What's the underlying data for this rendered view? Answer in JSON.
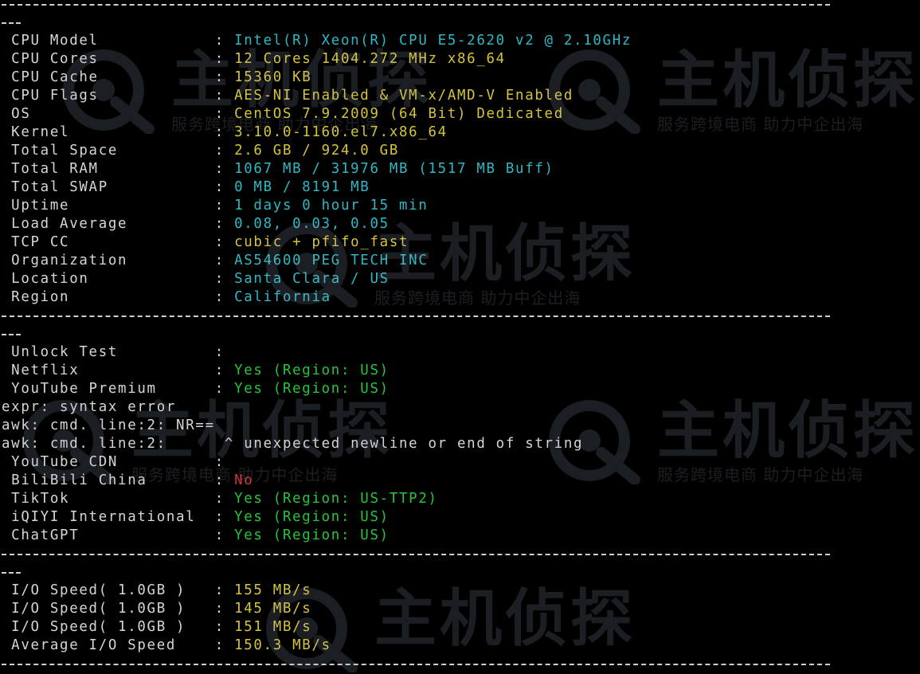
{
  "watermark": {
    "brand": "主机侦探",
    "slogan": "服务跨境电商 助力中企出海"
  },
  "colors": {
    "background": "#000000",
    "label": "#d6d6d6",
    "cyan": "#2fb8c4",
    "yellow": "#d6c43a",
    "green": "#27c43c",
    "red": "#d23232"
  },
  "sys_info": [
    {
      "label": " CPU Model            ",
      "sep": ": ",
      "value": "Intel(R) Xeon(R) CPU E5-2620 v2 @ 2.10GHz",
      "color": "cyan"
    },
    {
      "label": " CPU Cores            ",
      "sep": ": ",
      "value": "12 Cores 1404.272 MHz x86_64",
      "color": "yellow"
    },
    {
      "label": " CPU Cache            ",
      "sep": ": ",
      "value": "15360 KB",
      "color": "yellow"
    },
    {
      "label": " CPU Flags            ",
      "sep": ": ",
      "value": "AES-NI Enabled & VM-x/AMD-V Enabled",
      "color": "yellow"
    },
    {
      "label": " OS                   ",
      "sep": ": ",
      "value": "CentOS 7.9.2009 (64 Bit) Dedicated",
      "color": "yellow"
    },
    {
      "label": " Kernel               ",
      "sep": ": ",
      "value": "3.10.0-1160.el7.x86_64",
      "color": "yellow"
    },
    {
      "label": " Total Space          ",
      "sep": ": ",
      "value": "2.6 GB / 924.0 GB",
      "color": "yellow"
    },
    {
      "label": " Total RAM            ",
      "sep": ": ",
      "value": "1067 MB / 31976 MB (1517 MB Buff)",
      "color": "cyan"
    },
    {
      "label": " Total SWAP           ",
      "sep": ": ",
      "value": "0 MB / 8191 MB",
      "color": "cyan"
    },
    {
      "label": " Uptime               ",
      "sep": ": ",
      "value": "1 days 0 hour 15 min",
      "color": "cyan"
    },
    {
      "label": " Load Average         ",
      "sep": ": ",
      "value": "0.08, 0.03, 0.05",
      "color": "cyan"
    },
    {
      "label": " TCP CC               ",
      "sep": ": ",
      "value": "cubic + pfifo_fast",
      "color": "yellow"
    },
    {
      "label": " Organization         ",
      "sep": ": ",
      "value": "AS54600 PEG TECH INC",
      "color": "cyan"
    },
    {
      "label": " Location             ",
      "sep": ": ",
      "value": "Santa Clara / US",
      "color": "cyan"
    },
    {
      "label": " Region               ",
      "sep": ": ",
      "value": "California",
      "color": "cyan"
    }
  ],
  "unlock": {
    "header": {
      "label": " Unlock Test          ",
      "sep": ":",
      "value": ""
    },
    "lines": [
      {
        "label": " Netflix              ",
        "sep": ": ",
        "value": "Yes (Region: US)",
        "color": "green"
      },
      {
        "label": " YouTube Premium      ",
        "sep": ": ",
        "value": "Yes (Region: US)",
        "color": "green"
      },
      {
        "label": "expr: syntax error",
        "sep": "",
        "value": "",
        "color": "white"
      },
      {
        "label": "awk: cmd. line:2: NR==",
        "sep": "",
        "value": "",
        "color": "white"
      },
      {
        "label": "awk: cmd. line:2:      ",
        "sep": "^ ",
        "value": "unexpected newline or end of string",
        "color": "white"
      },
      {
        "label": " YouTube CDN          ",
        "sep": ":",
        "value": "",
        "color": "white"
      },
      {
        "label": " BiliBili China       ",
        "sep": ": ",
        "value": "No",
        "color": "red"
      },
      {
        "label": " TikTok               ",
        "sep": ": ",
        "value": "Yes (Region: US-TTP2)",
        "color": "green"
      },
      {
        "label": " iQIYI International  ",
        "sep": ": ",
        "value": "Yes (Region: US)",
        "color": "green"
      },
      {
        "label": " ChatGPT              ",
        "sep": ": ",
        "value": "Yes (Region: US)",
        "color": "green"
      }
    ]
  },
  "io": [
    {
      "label": " I/O Speed( 1.0GB )   ",
      "sep": ": ",
      "value": "155 MB/s",
      "color": "yellow"
    },
    {
      "label": " I/O Speed( 1.0GB )   ",
      "sep": ": ",
      "value": "145 MB/s",
      "color": "yellow"
    },
    {
      "label": " I/O Speed( 1.0GB )   ",
      "sep": ": ",
      "value": "151 MB/s",
      "color": "yellow"
    },
    {
      "label": " Average I/O Speed    ",
      "sep": ": ",
      "value": "150.3 MB/s",
      "color": "yellow"
    }
  ]
}
